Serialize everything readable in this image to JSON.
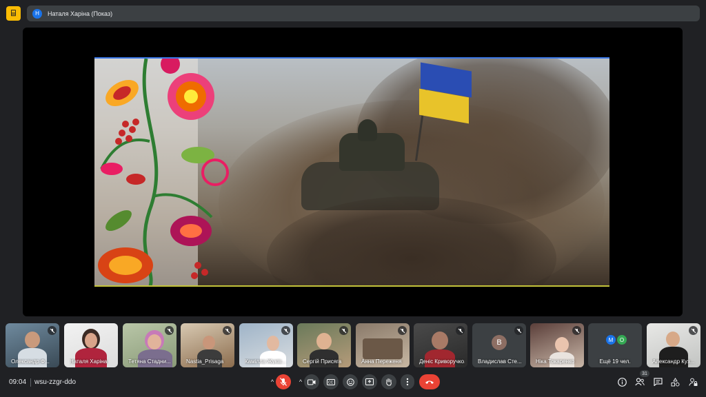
{
  "header": {
    "presenter_initial": "Н",
    "presenter_title": "Наталя Харіна (Показ)"
  },
  "participants": [
    {
      "name": "Олександр Ф...",
      "muted": true
    },
    {
      "name": "Наталя Харіна",
      "muted": false
    },
    {
      "name": "Тетяна Стадни...",
      "muted": true
    },
    {
      "name": "Nastia_Prisaga",
      "muted": true
    },
    {
      "name": "Камілла Жуків...",
      "muted": true
    },
    {
      "name": "Сергій Присяга",
      "muted": true
    },
    {
      "name": "Анна Переженя",
      "muted": true
    },
    {
      "name": "Деніс Криворучко...",
      "muted": true
    },
    {
      "name": "Владислав Сте...",
      "initial": "В",
      "muted": true
    },
    {
      "name": "Ніка Токаренко",
      "muted": true
    },
    {
      "name": "Ещё 19 чел.",
      "initials": [
        "М",
        "О"
      ]
    },
    {
      "name": "Александр Куз...",
      "muted": true
    }
  ],
  "footer": {
    "time": "09:04",
    "meeting_code": "wsu-zzgr-ddo",
    "participant_count": "31"
  },
  "colors": {
    "background": "#202124",
    "surface": "#3c4043",
    "danger": "#ea4335",
    "logo": "#fbbc04",
    "flag_blue": "#2a4db3",
    "flag_yellow": "#e8c32a"
  }
}
